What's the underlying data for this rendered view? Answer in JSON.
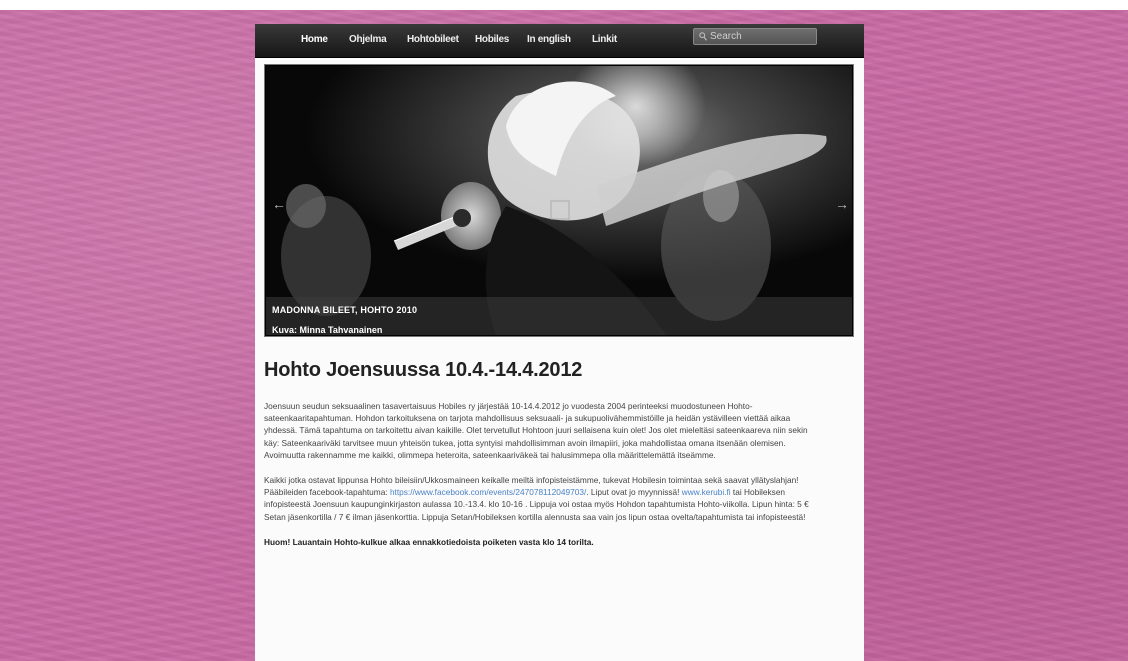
{
  "nav": {
    "items": [
      "Home",
      "Ohjelma",
      "Hohtobileet",
      "Hobiles",
      "In english",
      "Linkit"
    ],
    "search_placeholder": "Search"
  },
  "slider": {
    "caption_title": "MADONNA BILEET, HOHTO 2010",
    "caption_credit": "Kuva: Minna Tahvanainen",
    "prev_arrow": "←",
    "next_arrow": "→"
  },
  "article": {
    "title": "Hohto Joensuussa 10.4.-14.4.2012",
    "para1": "Joensuun seudun seksuaalinen tasavertaisuus Hobiles ry järjestää 10-14.4.2012 jo vuodesta 2004 perinteeksi muodostuneen Hohto-sateenkaaritapahtuman. Hohdon tarkoituksena on tarjota mahdollisuus seksuaali- ja sukupuolivähemmistöille ja heidän ystävilleen viettää aikaa yhdessä. Tämä tapahtuma on tarkoitettu aivan kaikille. Olet tervetullut Hohtoon juuri sellaisena kuin olet! Jos olet mieleltäsi sateenkaareva niin sekin käy: Sateenkaariväki tarvitsee muun yhteisön tukea, jotta syntyisi mahdollisimman avoin ilmapiiri, joka mahdollistaa omana itsenään olemisen. Avoimuutta rakennamme me kaikki, olimmepa heteroita, sateenkaariväkeä tai halusimmepa olla määrittelemättä itseämme.",
    "para2_part1": "Kaikki jotka ostavat lippunsa Hohto bileisiin/Ukkosmaineen keikalle meiltä infopisteistämme, tukevat Hobilesin toimintaa sekä saavat yllätyslahjan! Pääbileiden facebook-tapahtuma: ",
    "para2_link1": "https://www.facebook.com/events/247078112049703/",
    "para2_part2": ". Liput ovat jo myynnissä! ",
    "para2_link2": "www.kerubi.fi",
    "para2_part3": " tai Hobileksen infopisteestä Joensuun kaupunginkirjaston aulassa 10.-13.4. klo 10-16 . Lippuja voi ostaa myös Hohdon tapahtumista Hohto-viikolla. Lipun hinta: 5 € Setan jäsenkortilla / 7 € ilman jäsenkorttia. Lippuja Setan/Hobileksen kortilla alennusta saa vain jos lipun ostaa ovelta/tapahtumista tai infopisteestä!",
    "notice": "Huom! Lauantain Hohto-kulkue alkaa ennakkotiedoista poiketen vasta klo 14 torilta."
  }
}
